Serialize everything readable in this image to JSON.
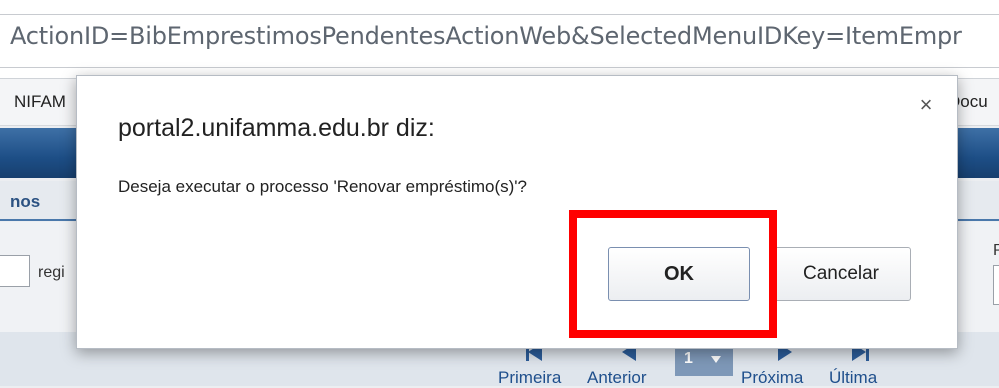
{
  "browser": {
    "url": "ActionID=BibEmprestimosPendentesActionWeb&SelectedMenuIDKey=ItemEmpr",
    "bookmark_left": "NIFAM",
    "bookmark_right": "Docu"
  },
  "page": {
    "section_title": "nos",
    "records_label": "regi",
    "right_label": "P",
    "pager": {
      "first": "Primeira",
      "previous": "Anterior",
      "current_page": "1",
      "next": "Próxima",
      "last": "Última"
    }
  },
  "dialog": {
    "title": "portal2.unifamma.edu.br diz:",
    "close_glyph": "×",
    "message": "Deseja executar o processo 'Renovar empréstimo(s)'?",
    "ok_label": "OK",
    "cancel_label": "Cancelar"
  },
  "annotation": {
    "highlight_color": "#ff0000"
  }
}
